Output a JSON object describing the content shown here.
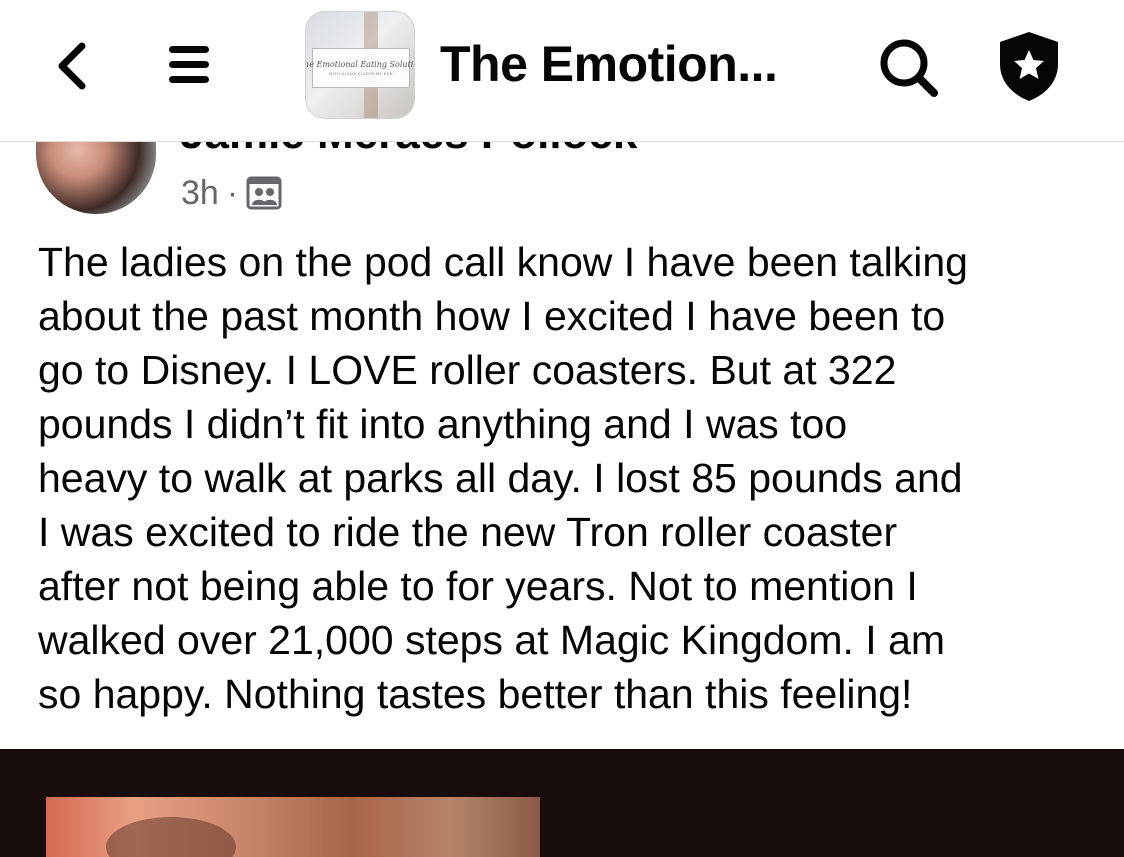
{
  "header": {
    "group_title": "The Emotion...",
    "group_thumbnail_caption": "The Emotional Eating Solution",
    "group_thumbnail_subcaption": "WITH ALANA KLUECK MS RDN",
    "back_icon": "chevron-left-icon",
    "menu_icon": "hamburger-menu-icon",
    "search_icon": "search-icon",
    "shield_icon": "shield-star-icon"
  },
  "post": {
    "author_name": "Jamie Meraes Pollock",
    "timestamp": "3h",
    "separator": "·",
    "audience_icon": "group-members-icon",
    "text_lines": [
      "The ladies on the pod call know I have been talking",
      "about the past month how I excited I have been to",
      "go to Disney. I LOVE roller coasters. But at 322",
      "pounds I didn’t fit into anything and I was too",
      "heavy to walk at parks all day. I lost 85 pounds and",
      "I was excited to ride the new Tron roller coaster",
      "after not being able to for years. Not to mention I",
      "walked over 21,000 steps at Magic Kingdom. I am",
      "so happy. Nothing tastes better than this feeling!"
    ]
  },
  "colors": {
    "text": "#050505",
    "secondary_text": "#65676b",
    "photo_background": "#190d0b"
  }
}
